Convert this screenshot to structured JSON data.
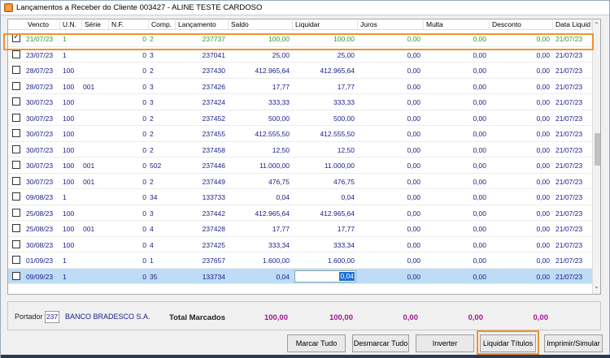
{
  "window": {
    "title": "Lançamentos a Receber do Cliente 003427 - ALINE TESTE CARDOSO"
  },
  "columns": [
    "Vencto",
    "U.N.",
    "Série",
    "N.F.",
    "Comp.",
    "Lançamento",
    "Saldo",
    "Liquidar",
    "Juros",
    "Multa",
    "Desconto",
    "Data Liquid"
  ],
  "rows": [
    {
      "checked": true,
      "vencto": "21/07/23",
      "un": "1",
      "serie": "",
      "nf": "0",
      "comp": "2",
      "lanc": "237737",
      "saldo": "100,00",
      "liquidar": "100,00",
      "juros": "0,00",
      "multa": "0,00",
      "desconto": "0,00",
      "data": "21/07/23"
    },
    {
      "checked": false,
      "vencto": "23/07/23",
      "un": "1",
      "serie": "",
      "nf": "0",
      "comp": "3",
      "lanc": "237041",
      "saldo": "25,00",
      "liquidar": "25,00",
      "juros": "0,00",
      "multa": "0,00",
      "desconto": "0,00",
      "data": "21/07/23"
    },
    {
      "checked": false,
      "vencto": "28/07/23",
      "un": "100",
      "serie": "",
      "nf": "0",
      "comp": "2",
      "lanc": "237430",
      "saldo": "412.965,64",
      "liquidar": "412.965,64",
      "juros": "0,00",
      "multa": "0,00",
      "desconto": "0,00",
      "data": "21/07/23"
    },
    {
      "checked": false,
      "vencto": "28/07/23",
      "un": "100",
      "serie": "001",
      "nf": "0",
      "comp": "3",
      "lanc": "237426",
      "saldo": "17,77",
      "liquidar": "17,77",
      "juros": "0,00",
      "multa": "0,00",
      "desconto": "0,00",
      "data": "21/07/23"
    },
    {
      "checked": false,
      "vencto": "30/07/23",
      "un": "100",
      "serie": "",
      "nf": "0",
      "comp": "3",
      "lanc": "237424",
      "saldo": "333,33",
      "liquidar": "333,33",
      "juros": "0,00",
      "multa": "0,00",
      "desconto": "0,00",
      "data": "21/07/23"
    },
    {
      "checked": false,
      "vencto": "30/07/23",
      "un": "100",
      "serie": "",
      "nf": "0",
      "comp": "2",
      "lanc": "237452",
      "saldo": "500,00",
      "liquidar": "500,00",
      "juros": "0,00",
      "multa": "0,00",
      "desconto": "0,00",
      "data": "21/07/23"
    },
    {
      "checked": false,
      "vencto": "30/07/23",
      "un": "100",
      "serie": "",
      "nf": "0",
      "comp": "2",
      "lanc": "237455",
      "saldo": "412.555,50",
      "liquidar": "412.555,50",
      "juros": "0,00",
      "multa": "0,00",
      "desconto": "0,00",
      "data": "21/07/23"
    },
    {
      "checked": false,
      "vencto": "30/07/23",
      "un": "100",
      "serie": "",
      "nf": "0",
      "comp": "2",
      "lanc": "237458",
      "saldo": "12,50",
      "liquidar": "12,50",
      "juros": "0,00",
      "multa": "0,00",
      "desconto": "0,00",
      "data": "21/07/23"
    },
    {
      "checked": false,
      "vencto": "30/07/23",
      "un": "100",
      "serie": "001",
      "nf": "0",
      "comp": "502",
      "lanc": "237446",
      "saldo": "11.000,00",
      "liquidar": "11.000,00",
      "juros": "0,00",
      "multa": "0,00",
      "desconto": "0,00",
      "data": "21/07/23"
    },
    {
      "checked": false,
      "vencto": "30/07/23",
      "un": "100",
      "serie": "001",
      "nf": "0",
      "comp": "2",
      "lanc": "237449",
      "saldo": "476,75",
      "liquidar": "476,75",
      "juros": "0,00",
      "multa": "0,00",
      "desconto": "0,00",
      "data": "21/07/23"
    },
    {
      "checked": false,
      "vencto": "09/08/23",
      "un": "1",
      "serie": "",
      "nf": "0",
      "comp": "34",
      "lanc": "133733",
      "saldo": "0,04",
      "liquidar": "0,04",
      "juros": "0,00",
      "multa": "0,00",
      "desconto": "0,00",
      "data": "21/07/23"
    },
    {
      "checked": false,
      "vencto": "25/08/23",
      "un": "100",
      "serie": "",
      "nf": "0",
      "comp": "3",
      "lanc": "237442",
      "saldo": "412.965,64",
      "liquidar": "412.965,64",
      "juros": "0,00",
      "multa": "0,00",
      "desconto": "0,00",
      "data": "21/07/23"
    },
    {
      "checked": false,
      "vencto": "25/08/23",
      "un": "100",
      "serie": "001",
      "nf": "0",
      "comp": "4",
      "lanc": "237428",
      "saldo": "17,77",
      "liquidar": "17,77",
      "juros": "0,00",
      "multa": "0,00",
      "desconto": "0,00",
      "data": "21/07/23"
    },
    {
      "checked": false,
      "vencto": "30/08/23",
      "un": "100",
      "serie": "",
      "nf": "0",
      "comp": "4",
      "lanc": "237425",
      "saldo": "333,34",
      "liquidar": "333,34",
      "juros": "0,00",
      "multa": "0,00",
      "desconto": "0,00",
      "data": "21/07/23"
    },
    {
      "checked": false,
      "vencto": "01/09/23",
      "un": "1",
      "serie": "",
      "nf": "0",
      "comp": "1",
      "lanc": "237657",
      "saldo": "1.600,00",
      "liquidar": "1.600,00",
      "juros": "0,00",
      "multa": "0,00",
      "desconto": "0,00",
      "data": "21/07/23"
    },
    {
      "checked": false,
      "vencto": "09/09/23",
      "un": "1",
      "serie": "",
      "nf": "0",
      "comp": "35",
      "lanc": "133734",
      "saldo": "0,04",
      "liquidar": "0,04",
      "juros": "0,00",
      "multa": "0,00",
      "desconto": "0,00",
      "data": "21/07/23"
    }
  ],
  "footer": {
    "portador_label": "Portador",
    "portador_code": "237",
    "portador_name": "BANCO BRADESCO S.A.",
    "total_label": "Total Marcados",
    "total_saldo": "100,00",
    "total_liquidar": "100,00",
    "total_juros": "0,00",
    "total_multa": "0,00",
    "total_desconto": "0,00"
  },
  "buttons": {
    "marcar": "Marcar Tudo",
    "desmarcar": "Desmarcar Tudo",
    "inverter": "Inverter",
    "liquidar": "Liquidar Títulos",
    "imprimir": "Imprimir/Simular"
  },
  "colors": {
    "accent_highlight": "#f0922e",
    "green_row": "#2f9b2f",
    "total_purple": "#a01890",
    "row_selected": "#bedcf6"
  }
}
